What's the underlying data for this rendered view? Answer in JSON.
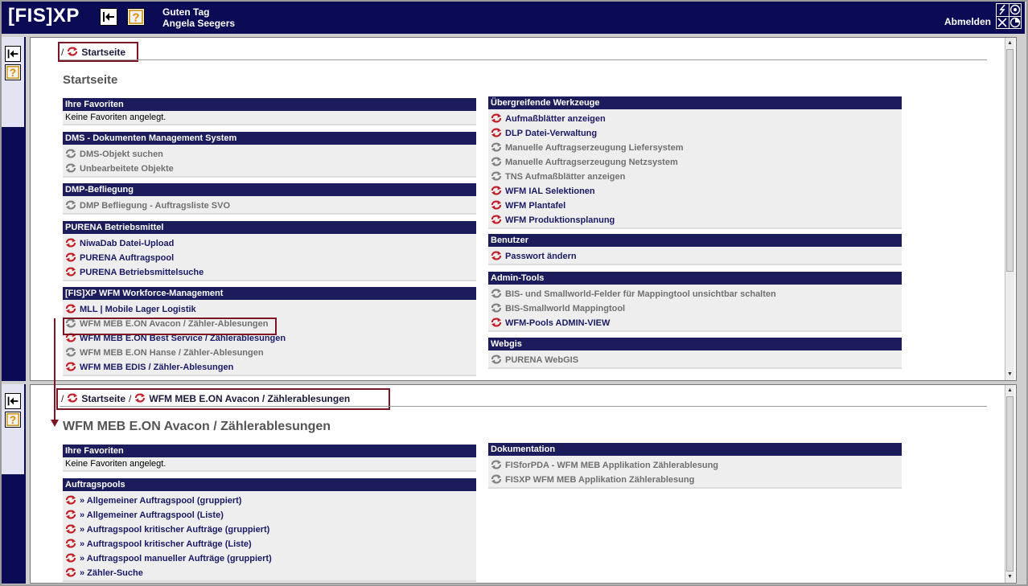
{
  "header": {
    "logo": "[FIS]XP",
    "greeting": "Guten Tag",
    "user_name": "Angela Seegers",
    "logout_label": "Abmelden",
    "help_glyph": "?"
  },
  "top_frame": {
    "breadcrumb": [
      {
        "label": "Startseite",
        "icon": "refresh-icon"
      }
    ],
    "title": "Startseite",
    "left_sections": [
      {
        "title": "Ihre Favoriten",
        "text": "Keine Favoriten angelegt.",
        "links": []
      },
      {
        "title": "DMS - Dokumenten Management System",
        "links": [
          {
            "label": "DMS-Objekt suchen",
            "active": false
          },
          {
            "label": "Unbearbeitete Objekte",
            "active": false
          }
        ]
      },
      {
        "title": "DMP-Befliegung",
        "links": [
          {
            "label": "DMP Befliegung - Auftragsliste SVO",
            "active": false
          }
        ]
      },
      {
        "title": "PURENA Betriebsmittel",
        "links": [
          {
            "label": "NiwaDab Datei-Upload",
            "active": true
          },
          {
            "label": "PURENA Auftragspool",
            "active": true
          },
          {
            "label": "PURENA Betriebsmittelsuche",
            "active": true
          }
        ]
      },
      {
        "title": "[FIS]XP WFM Workforce-Management",
        "links": [
          {
            "label": "MLL | Mobile Lager Logistik",
            "active": true
          },
          {
            "label": "WFM MEB E.ON Avacon / Zähler-Ablesungen",
            "active": false
          },
          {
            "label": "WFM MEB E.ON Best Service / Zählerablesungen",
            "active": true
          },
          {
            "label": "WFM MEB E.ON Hanse / Zähler-Ablesungen",
            "active": false
          },
          {
            "label": "WFM MEB EDIS / Zähler-Ablesungen",
            "active": true
          }
        ]
      }
    ],
    "right_sections": [
      {
        "title": "Übergreifende Werkzeuge",
        "links": [
          {
            "label": "Aufmaßblätter anzeigen",
            "active": true
          },
          {
            "label": "DLP Datei-Verwaltung",
            "active": true
          },
          {
            "label": "Manuelle Auftragserzeugung Liefersystem",
            "active": false
          },
          {
            "label": "Manuelle Auftragserzeugung Netzsystem",
            "active": false
          },
          {
            "label": "TNS Aufmaßblätter anzeigen",
            "active": false
          },
          {
            "label": "WFM IAL Selektionen",
            "active": true
          },
          {
            "label": "WFM Plantafel",
            "active": true
          },
          {
            "label": "WFM Produktionsplanung",
            "active": true
          }
        ]
      },
      {
        "title": "Benutzer",
        "links": [
          {
            "label": "Passwort ändern",
            "active": true
          }
        ]
      },
      {
        "title": "Admin-Tools",
        "links": [
          {
            "label": "BIS- und Smallworld-Felder für Mappingtool unsichtbar schalten",
            "active": false
          },
          {
            "label": "BIS-Smallworld Mappingtool",
            "active": false
          },
          {
            "label": "WFM-Pools ADMIN-VIEW",
            "active": true
          }
        ]
      },
      {
        "title": "Webgis",
        "links": [
          {
            "label": "PURENA WebGIS",
            "active": false
          }
        ]
      }
    ]
  },
  "bottom_frame": {
    "breadcrumb": [
      {
        "label": "Startseite",
        "icon": "refresh-icon"
      },
      {
        "label": "WFM MEB E.ON Avacon / Zählerablesungen",
        "icon": "refresh-icon"
      }
    ],
    "title": "WFM MEB E.ON Avacon / Zählerablesungen",
    "left_sections": [
      {
        "title": "Ihre Favoriten",
        "text": "Keine Favoriten angelegt.",
        "links": []
      },
      {
        "title": "Auftragspools",
        "links": [
          {
            "label": "» Allgemeiner Auftragspool (gruppiert)",
            "active": true
          },
          {
            "label": "» Allgemeiner Auftragspool (Liste)",
            "active": true
          },
          {
            "label": "» Auftragspool kritischer Aufträge (gruppiert)",
            "active": true
          },
          {
            "label": "» Auftragspool kritischer Aufträge (Liste)",
            "active": true
          },
          {
            "label": "» Auftragspool manueller Aufträge (gruppiert)",
            "active": true
          },
          {
            "label": "» Zähler-Suche",
            "active": true
          }
        ]
      }
    ],
    "right_sections": [
      {
        "title": "Dokumentation",
        "links": [
          {
            "label": "FISforPDA - WFM MEB Applikation Zählerablesung",
            "active": false
          },
          {
            "label": "FISXP WFM MEB Applikation Zählerablesung",
            "active": false
          }
        ]
      }
    ]
  },
  "colors": {
    "navy": "#0b0b55",
    "section_header": "#1c1c5c",
    "active_icon": "#c0202a",
    "inactive_icon": "#808080",
    "highlight_box": "#7d1622"
  }
}
